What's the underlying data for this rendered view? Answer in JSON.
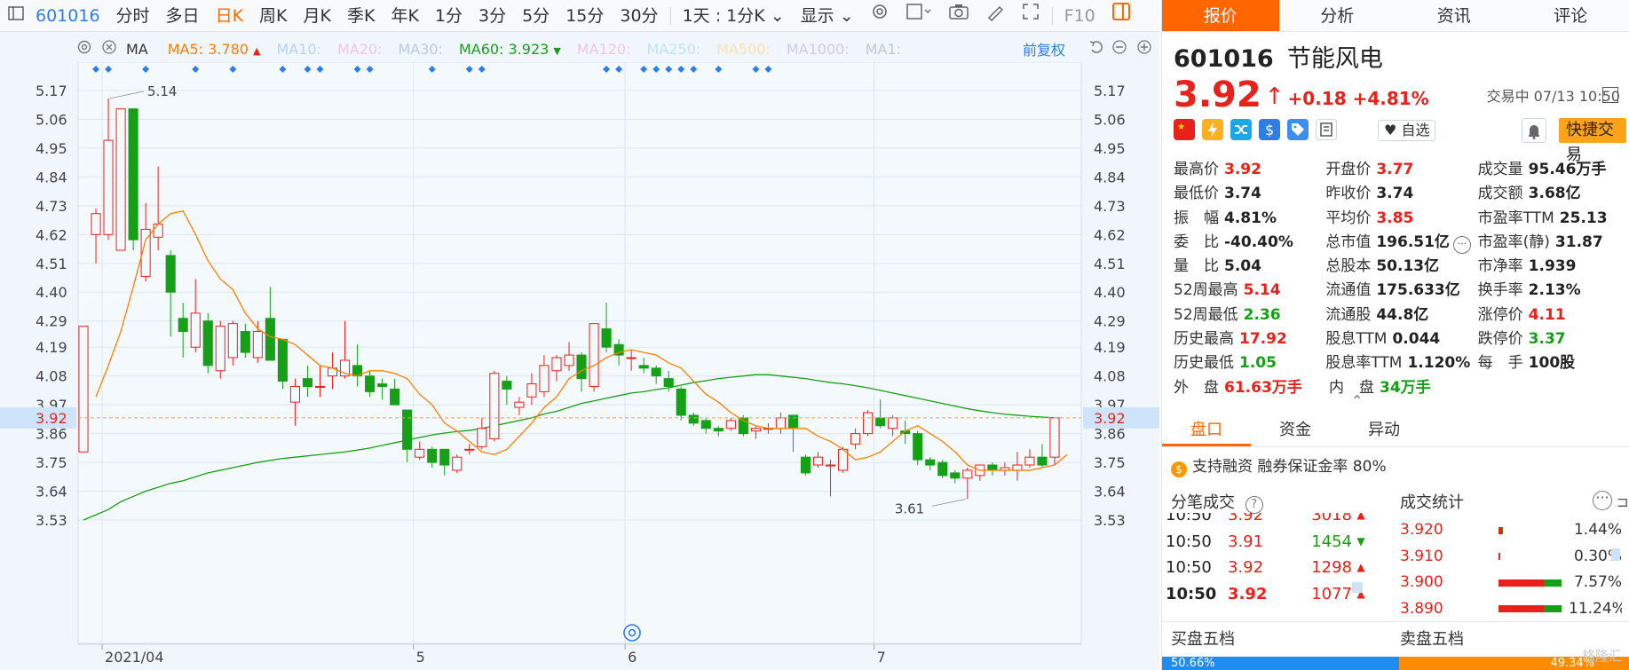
{
  "toolbar": {
    "code": "601016",
    "items": [
      "分时",
      "多日",
      "日K",
      "周K",
      "月K",
      "季K",
      "年K",
      "1分",
      "3分",
      "5分",
      "15分",
      "30分"
    ],
    "active": "日K",
    "range": "1天 : 1分K",
    "display": "显示",
    "f10": "F10"
  },
  "ma_bar": {
    "selector": "MA",
    "entries": [
      {
        "label": "MA5: 3.780",
        "color": "#ff7f00",
        "arrow": "up"
      },
      {
        "label": "MA10:",
        "color": "#b3d4f3"
      },
      {
        "label": "MA20:",
        "color": "#f3c6de"
      },
      {
        "label": "MA30:",
        "color": "#b8cbe8"
      },
      {
        "label": "MA60: 3.923",
        "color": "#16a016",
        "arrow": "down"
      },
      {
        "label": "MA120:",
        "color": "#f3c6de"
      },
      {
        "label": "MA250:",
        "color": "#bfe3f6"
      },
      {
        "label": "MA500:",
        "color": "#f8e2b0"
      },
      {
        "label": "MA1000:",
        "color": "#d4c6ec"
      },
      {
        "label": "MA1:",
        "color": "#c0c8d2"
      }
    ],
    "restore": "前复权"
  },
  "chart_data": {
    "type": "candlestick",
    "y_ticks": [
      "5.17",
      "5.06",
      "4.95",
      "4.84",
      "4.73",
      "4.62",
      "4.51",
      "4.40",
      "4.29",
      "4.19",
      "4.08",
      "3.97",
      "3.86",
      "3.75",
      "3.64",
      "3.53"
    ],
    "ylim": [
      3.48,
      5.2
    ],
    "current_price_label": "3.92",
    "current_price": 3.92,
    "high_label": "5.14",
    "low_label": "3.61",
    "x_labels": [
      "2021/04",
      "5",
      "6",
      "7"
    ],
    "x_label_days": [
      5,
      30,
      47,
      67
    ],
    "candles": [
      {
        "o": 3.79,
        "c": 4.27,
        "h": 4.27,
        "l": 3.79
      },
      {
        "o": 4.62,
        "c": 4.7,
        "h": 4.72,
        "l": 4.51
      },
      {
        "o": 4.62,
        "c": 4.98,
        "h": 5.14,
        "l": 4.6
      },
      {
        "o": 4.56,
        "c": 5.1,
        "h": 5.1,
        "l": 4.56
      },
      {
        "o": 5.1,
        "c": 4.6,
        "h": 5.1,
        "l": 4.56
      },
      {
        "o": 4.46,
        "c": 4.64,
        "h": 4.74,
        "l": 4.44
      },
      {
        "o": 4.61,
        "c": 4.66,
        "h": 4.88,
        "l": 4.56
      },
      {
        "o": 4.54,
        "c": 4.4,
        "h": 4.56,
        "l": 4.23
      },
      {
        "o": 4.3,
        "c": 4.25,
        "h": 4.36,
        "l": 4.15
      },
      {
        "o": 4.19,
        "c": 4.32,
        "h": 4.45,
        "l": 4.17
      },
      {
        "o": 4.29,
        "c": 4.12,
        "h": 4.32,
        "l": 4.09
      },
      {
        "o": 4.1,
        "c": 4.27,
        "h": 4.29,
        "l": 4.07
      },
      {
        "o": 4.15,
        "c": 4.28,
        "h": 4.29,
        "l": 4.12
      },
      {
        "o": 4.25,
        "c": 4.17,
        "h": 4.28,
        "l": 4.15
      },
      {
        "o": 4.15,
        "c": 4.25,
        "h": 4.29,
        "l": 4.13
      },
      {
        "o": 4.3,
        "c": 4.14,
        "h": 4.42,
        "l": 4.14
      },
      {
        "o": 4.22,
        "c": 4.06,
        "h": 4.22,
        "l": 4.03
      },
      {
        "o": 3.98,
        "c": 4.04,
        "h": 4.07,
        "l": 3.89
      },
      {
        "o": 4.07,
        "c": 4.04,
        "h": 4.12,
        "l": 4.0
      },
      {
        "o": 4.04,
        "c": 4.04,
        "h": 4.12,
        "l": 4.0
      },
      {
        "o": 4.08,
        "c": 4.11,
        "h": 4.17,
        "l": 4.03
      },
      {
        "o": 4.08,
        "c": 4.14,
        "h": 4.29,
        "l": 4.07
      },
      {
        "o": 4.12,
        "c": 4.08,
        "h": 4.2,
        "l": 4.04
      },
      {
        "o": 4.08,
        "c": 4.02,
        "h": 4.1,
        "l": 4.0
      },
      {
        "o": 4.05,
        "c": 4.04,
        "h": 4.07,
        "l": 3.99
      },
      {
        "o": 4.03,
        "c": 3.97,
        "h": 4.07,
        "l": 3.97
      },
      {
        "o": 3.95,
        "c": 3.8,
        "h": 3.95,
        "l": 3.75
      },
      {
        "o": 3.77,
        "c": 3.8,
        "h": 3.83,
        "l": 3.76
      },
      {
        "o": 3.8,
        "c": 3.75,
        "h": 3.81,
        "l": 3.73
      },
      {
        "o": 3.8,
        "c": 3.74,
        "h": 3.8,
        "l": 3.7
      },
      {
        "o": 3.72,
        "c": 3.77,
        "h": 3.78,
        "l": 3.71
      },
      {
        "o": 3.8,
        "c": 3.8,
        "h": 3.82,
        "l": 3.78
      },
      {
        "o": 3.81,
        "c": 3.88,
        "h": 3.92,
        "l": 3.8
      },
      {
        "o": 3.84,
        "c": 4.09,
        "h": 4.1,
        "l": 3.83
      },
      {
        "o": 4.06,
        "c": 4.03,
        "h": 4.08,
        "l": 3.97
      },
      {
        "o": 3.96,
        "c": 3.98,
        "h": 4.0,
        "l": 3.93
      },
      {
        "o": 4.0,
        "c": 4.05,
        "h": 4.09,
        "l": 3.97
      },
      {
        "o": 4.02,
        "c": 4.12,
        "h": 4.16,
        "l": 4.0
      },
      {
        "o": 4.1,
        "c": 4.15,
        "h": 4.16,
        "l": 4.06
      },
      {
        "o": 4.12,
        "c": 4.16,
        "h": 4.21,
        "l": 4.1
      },
      {
        "o": 4.16,
        "c": 4.07,
        "h": 4.17,
        "l": 4.02
      },
      {
        "o": 4.04,
        "c": 4.28,
        "h": 4.28,
        "l": 4.02
      },
      {
        "o": 4.26,
        "c": 4.19,
        "h": 4.36,
        "l": 4.17
      },
      {
        "o": 4.2,
        "c": 4.16,
        "h": 4.22,
        "l": 4.12
      },
      {
        "o": 4.15,
        "c": 4.15,
        "h": 4.18,
        "l": 4.1
      },
      {
        "o": 4.12,
        "c": 4.11,
        "h": 4.15,
        "l": 4.09
      },
      {
        "o": 4.11,
        "c": 4.08,
        "h": 4.12,
        "l": 4.05
      },
      {
        "o": 4.07,
        "c": 4.04,
        "h": 4.1,
        "l": 4.02
      },
      {
        "o": 4.03,
        "c": 3.93,
        "h": 4.04,
        "l": 3.91
      },
      {
        "o": 3.93,
        "c": 3.9,
        "h": 3.94,
        "l": 3.89
      },
      {
        "o": 3.91,
        "c": 3.88,
        "h": 3.92,
        "l": 3.86
      },
      {
        "o": 3.88,
        "c": 3.87,
        "h": 3.89,
        "l": 3.85
      },
      {
        "o": 3.88,
        "c": 3.91,
        "h": 3.92,
        "l": 3.87
      },
      {
        "o": 3.92,
        "c": 3.86,
        "h": 3.93,
        "l": 3.85
      },
      {
        "o": 3.87,
        "c": 3.88,
        "h": 3.89,
        "l": 3.84
      },
      {
        "o": 3.88,
        "c": 3.88,
        "h": 3.9,
        "l": 3.86
      },
      {
        "o": 3.88,
        "c": 3.92,
        "h": 3.94,
        "l": 3.86
      },
      {
        "o": 3.93,
        "c": 3.88,
        "h": 3.93,
        "l": 3.79
      },
      {
        "o": 3.77,
        "c": 3.71,
        "h": 3.78,
        "l": 3.7
      },
      {
        "o": 3.74,
        "c": 3.77,
        "h": 3.79,
        "l": 3.73
      },
      {
        "o": 3.74,
        "c": 3.74,
        "h": 3.76,
        "l": 3.62
      },
      {
        "o": 3.72,
        "c": 3.8,
        "h": 3.81,
        "l": 3.71
      },
      {
        "o": 3.82,
        "c": 3.86,
        "h": 3.88,
        "l": 3.8
      },
      {
        "o": 3.86,
        "c": 3.94,
        "h": 3.95,
        "l": 3.85
      },
      {
        "o": 3.92,
        "c": 3.89,
        "h": 3.99,
        "l": 3.88
      },
      {
        "o": 3.88,
        "c": 3.92,
        "h": 3.93,
        "l": 3.85
      },
      {
        "o": 3.87,
        "c": 3.86,
        "h": 3.91,
        "l": 3.82
      },
      {
        "o": 3.86,
        "c": 3.76,
        "h": 3.87,
        "l": 3.74
      },
      {
        "o": 3.76,
        "c": 3.74,
        "h": 3.77,
        "l": 3.72
      },
      {
        "o": 3.75,
        "c": 3.7,
        "h": 3.76,
        "l": 3.69
      },
      {
        "o": 3.71,
        "c": 3.69,
        "h": 3.72,
        "l": 3.67
      },
      {
        "o": 3.69,
        "c": 3.72,
        "h": 3.73,
        "l": 3.61
      },
      {
        "o": 3.7,
        "c": 3.74,
        "h": 3.74,
        "l": 3.68
      },
      {
        "o": 3.74,
        "c": 3.72,
        "h": 3.75,
        "l": 3.7
      },
      {
        "o": 3.72,
        "c": 3.73,
        "h": 3.75,
        "l": 3.7
      },
      {
        "o": 3.72,
        "c": 3.74,
        "h": 3.79,
        "l": 3.68
      },
      {
        "o": 3.74,
        "c": 3.77,
        "h": 3.8,
        "l": 3.73
      },
      {
        "o": 3.77,
        "c": 3.74,
        "h": 3.82,
        "l": 3.73
      },
      {
        "o": 3.77,
        "c": 3.92,
        "h": 3.92,
        "l": 3.74
      }
    ],
    "ma5": [
      4.0,
      4.12,
      4.25,
      4.42,
      4.6,
      4.66,
      4.7,
      4.71,
      4.62,
      4.52,
      4.45,
      4.41,
      4.32,
      4.26,
      4.23,
      4.22,
      4.2,
      4.16,
      4.12,
      4.11,
      4.09,
      4.08,
      4.1,
      4.1,
      4.09,
      4.07,
      4.01,
      3.97,
      3.9,
      3.87,
      3.83,
      3.79,
      3.78,
      3.8,
      3.85,
      3.9,
      3.96,
      4.0,
      4.07,
      4.1,
      4.12,
      4.15,
      4.17,
      4.18,
      4.17,
      4.16,
      4.13,
      4.11,
      4.06,
      4.01,
      3.98,
      3.94,
      3.91,
      3.89,
      3.88,
      3.88,
      3.88,
      3.88,
      3.85,
      3.83,
      3.8,
      3.76,
      3.77,
      3.79,
      3.83,
      3.87,
      3.89,
      3.86,
      3.83,
      3.79,
      3.74,
      3.72,
      3.72,
      3.72,
      3.72,
      3.72,
      3.73,
      3.74,
      3.78
    ],
    "ma60": [
      3.53,
      3.55,
      3.57,
      3.6,
      3.62,
      3.64,
      3.655,
      3.67,
      3.68,
      3.695,
      3.71,
      3.72,
      3.73,
      3.74,
      3.75,
      3.758,
      3.765,
      3.77,
      3.775,
      3.78,
      3.785,
      3.79,
      3.797,
      3.805,
      3.815,
      3.825,
      3.835,
      3.845,
      3.855,
      3.862,
      3.868,
      3.872,
      3.88,
      3.89,
      3.9,
      3.91,
      3.92,
      3.935,
      3.945,
      3.96,
      3.975,
      3.985,
      3.995,
      4.005,
      4.015,
      4.02,
      4.028,
      4.035,
      4.045,
      4.055,
      4.062,
      4.07,
      4.075,
      4.08,
      4.085,
      4.085,
      4.08,
      4.075,
      4.07,
      4.062,
      4.055,
      4.05,
      4.043,
      4.035,
      4.025,
      4.015,
      4.005,
      3.995,
      3.985,
      3.975,
      3.965,
      3.955,
      3.947,
      3.94,
      3.934,
      3.93,
      3.926,
      3.923,
      3.92
    ],
    "markers_x": [
      1,
      2,
      5,
      9,
      12,
      16,
      18,
      19,
      22,
      23,
      28,
      31,
      32,
      42,
      43,
      45,
      46,
      47,
      48,
      49,
      51,
      54,
      55
    ]
  },
  "quote": {
    "code": "601016",
    "name": "节能风电",
    "price": "3.92",
    "arrow": "↑",
    "change": "+0.18  +4.81%",
    "status": "交易中 07/13 10:50",
    "fav": "自选",
    "quick_trade": "快捷交易"
  },
  "right_tabs": [
    "报价",
    "分析",
    "资讯",
    "评论"
  ],
  "stats": [
    [
      {
        "l": "最高价",
        "v": "3.92",
        "c": "red"
      },
      {
        "l": "开盘价",
        "v": "3.77",
        "c": "red"
      },
      {
        "l": "成交量",
        "v": "95.46万手",
        "c": "dark"
      }
    ],
    [
      {
        "l": "最低价",
        "v": "3.74",
        "c": "dark"
      },
      {
        "l": "昨收价",
        "v": "3.74",
        "c": "dark"
      },
      {
        "l": "成交额",
        "v": "3.68亿",
        "c": "dark"
      }
    ],
    [
      {
        "l": "振　幅",
        "v": "4.81%",
        "c": "dark"
      },
      {
        "l": "平均价",
        "v": "3.85",
        "c": "red"
      },
      {
        "l": "市盈率TTM",
        "v": "25.13",
        "c": "dark"
      }
    ],
    [
      {
        "l": "委　比",
        "v": "-40.40%",
        "c": "dark"
      },
      {
        "l": "总市值",
        "v": "196.51亿",
        "c": "dark"
      },
      {
        "l": "市盈率(静)",
        "v": "31.87",
        "c": "dark"
      }
    ],
    [
      {
        "l": "量　比",
        "v": "5.04",
        "c": "dark"
      },
      {
        "l": "总股本",
        "v": "50.13亿",
        "c": "dark"
      },
      {
        "l": "市净率",
        "v": "1.939",
        "c": "dark"
      }
    ],
    [
      {
        "l": "52周最高",
        "v": "5.14",
        "c": "red"
      },
      {
        "l": "流通值",
        "v": "175.633亿",
        "c": "dark"
      },
      {
        "l": "换手率",
        "v": "2.13%",
        "c": "dark"
      }
    ],
    [
      {
        "l": "52周最低",
        "v": "2.36",
        "c": "green"
      },
      {
        "l": "流通股",
        "v": "44.8亿",
        "c": "dark"
      },
      {
        "l": "涨停价",
        "v": "4.11",
        "c": "red"
      }
    ],
    [
      {
        "l": "历史最高",
        "v": "17.92",
        "c": "red"
      },
      {
        "l": "股息TTM",
        "v": "0.044",
        "c": "dark"
      },
      {
        "l": "跌停价",
        "v": "3.37",
        "c": "green"
      }
    ],
    [
      {
        "l": "历史最低",
        "v": "1.05",
        "c": "green"
      },
      {
        "l": "股息率TTM",
        "v": "1.120%",
        "c": "dark"
      },
      {
        "l": "每　手",
        "v": "100股",
        "c": "dark"
      }
    ],
    [
      {
        "l": "外　盘",
        "v": "61.63万手",
        "c": "red"
      },
      {
        "l": "内　盘",
        "v": "34万手",
        "c": "green"
      }
    ]
  ],
  "sub_tabs": [
    "盘口",
    "资金",
    "异动"
  ],
  "margin_text": "支持融资 融券保证金率 80%",
  "ticks_title": "分笔成交",
  "ticks": [
    {
      "t": "10:50",
      "p": "3.92",
      "v": "3018",
      "d": "up"
    },
    {
      "t": "10:50",
      "p": "3.91",
      "v": "1454",
      "d": "down"
    },
    {
      "t": "10:50",
      "p": "3.92",
      "v": "1298",
      "d": "up"
    },
    {
      "t": "10:50",
      "p": "3.92",
      "v": "1077",
      "d": "up"
    }
  ],
  "vstats_title": "成交统计",
  "vstats": [
    {
      "p": "3.920",
      "pct": "1.44%",
      "frac": 0.06
    },
    {
      "p": "3.910",
      "pct": "0.30%",
      "frac": 0.01
    },
    {
      "p": "3.900",
      "pct": "7.57%",
      "frac": 0.95
    },
    {
      "p": "3.890",
      "pct": "11.24%",
      "frac": 0.95
    }
  ],
  "book": {
    "buy": "买盘五档",
    "sell": "卖盘五档",
    "buy_pct": "50.66%",
    "sell_pct": "49.34%",
    "buy_frac": 0.5066
  },
  "watermark": "格隆汇"
}
